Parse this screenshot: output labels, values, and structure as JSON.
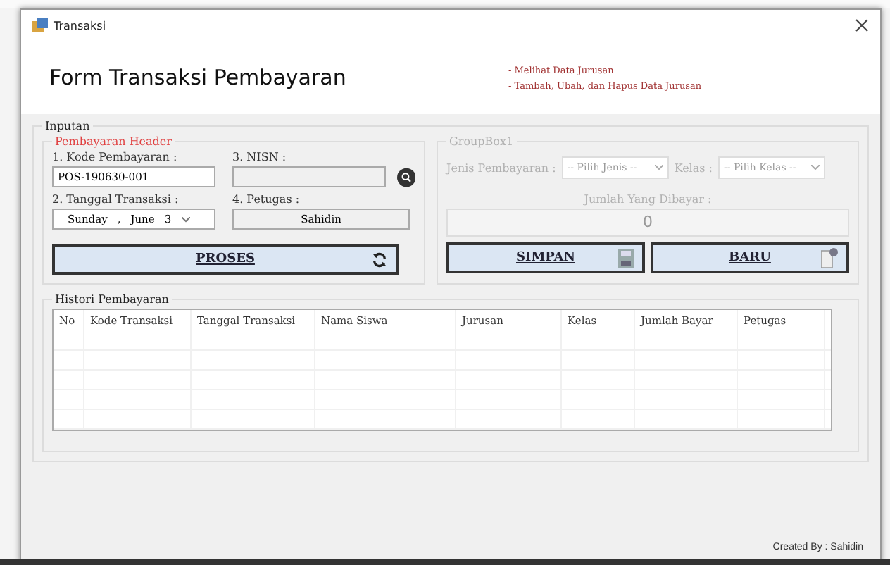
{
  "window": {
    "title": "Transaksi"
  },
  "header": {
    "title": "Form Transaksi Pembayaran",
    "links": [
      "- Melihat Data Jurusan",
      "- Tambah, Ubah, dan Hapus Data Jurusan"
    ]
  },
  "input_group": {
    "title": "Inputan",
    "header_group": {
      "title": "Pembayaran Header",
      "kode": {
        "label": "1. Kode Pembayaran :",
        "value": "POS-190630-001"
      },
      "nisn": {
        "label": "3. NISN :"
      },
      "tanggal": {
        "label": "2. Tanggal Transaksi :",
        "day": "Sunday",
        "sep": ",",
        "month": "June",
        "date": "3"
      },
      "petugas": {
        "label": "4. Petugas :",
        "value": "Sahidin"
      },
      "proses_button": "PROSES"
    },
    "groupbox1": {
      "title": "GroupBox1",
      "disabled": true,
      "jenis": {
        "label": "Jenis Pembayaran :",
        "value": "-- Pilih Jenis --"
      },
      "kelas": {
        "label": "Kelas :",
        "value": "-- Pilih Kelas --"
      },
      "jumlah": {
        "label": "Jumlah Yang Dibayar :",
        "value": "0"
      },
      "simpan_button": "SIMPAN",
      "baru_button": "BARU"
    }
  },
  "history": {
    "title": "Histori Pembayaran",
    "columns": [
      "No",
      "Kode Transaksi",
      "Tanggal Transaksi",
      "Nama Siswa",
      "Jurusan",
      "Kelas",
      "Jumlah Bayar",
      "Petugas"
    ]
  },
  "footer": "Created By : Sahidin"
}
